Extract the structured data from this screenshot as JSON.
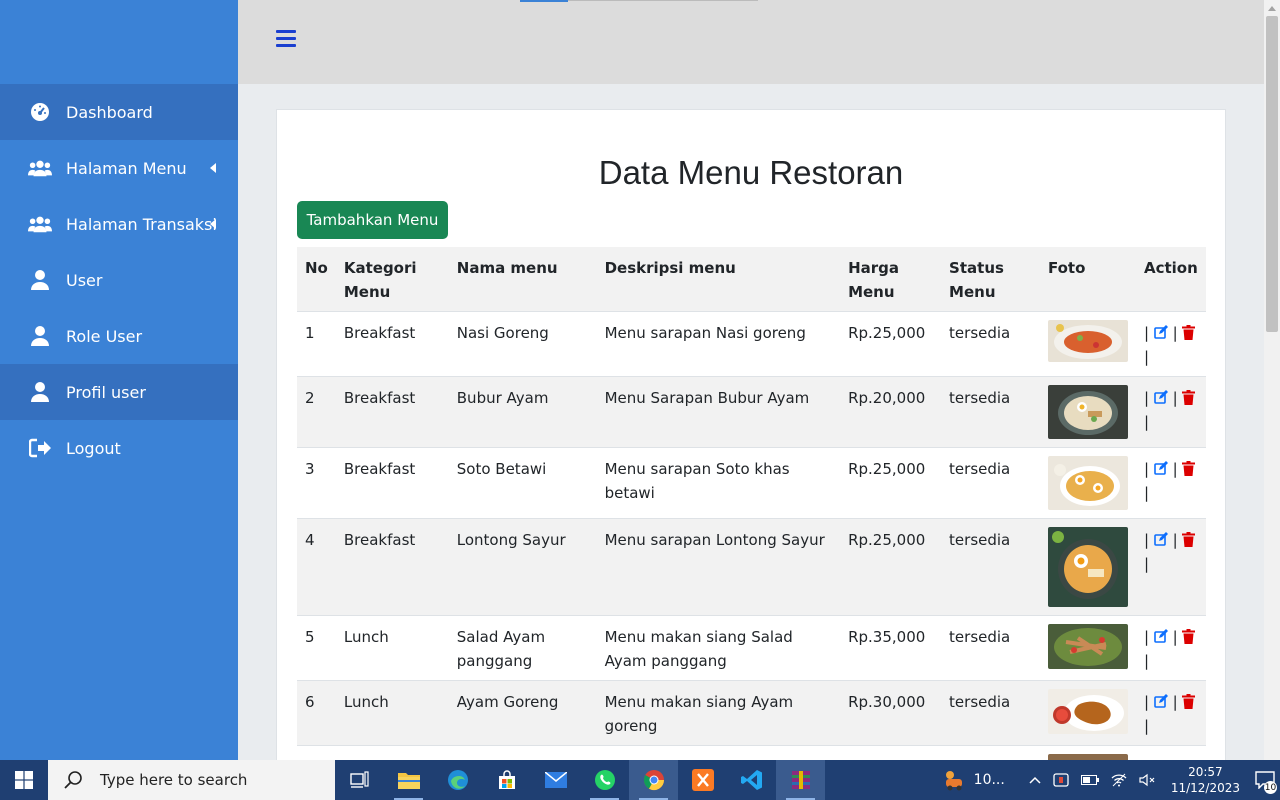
{
  "sidebar": {
    "items": [
      {
        "label": "Dashboard",
        "icon": "gauge-icon"
      },
      {
        "label": "Halaman Menu",
        "icon": "users-icon"
      },
      {
        "label": "Halaman Transaksi",
        "icon": "users-icon"
      },
      {
        "label": "User",
        "icon": "user-icon"
      },
      {
        "label": "Role User",
        "icon": "user-icon"
      },
      {
        "label": "Profil user",
        "icon": "user-icon"
      },
      {
        "label": "Logout",
        "icon": "logout-icon"
      }
    ]
  },
  "page": {
    "title": "Data Menu Restoran",
    "add_button": "Tambahkan Menu"
  },
  "table": {
    "headers": [
      "No",
      "Kategori Menu",
      "Nama menu",
      "Deskripsi menu",
      "Harga Menu",
      "Status Menu",
      "Foto",
      "Action"
    ],
    "rows": [
      {
        "no": "1",
        "kategori": "Breakfast",
        "nama": "Nasi Goreng",
        "deskripsi": "Menu sarapan Nasi goreng",
        "harga": "Rp.25,000",
        "status": "tersedia"
      },
      {
        "no": "2",
        "kategori": "Breakfast",
        "nama": "Bubur Ayam",
        "deskripsi": "Menu Sarapan Bubur Ayam",
        "harga": "Rp.20,000",
        "status": "tersedia"
      },
      {
        "no": "3",
        "kategori": "Breakfast",
        "nama": "Soto Betawi",
        "deskripsi": "Menu sarapan Soto khas betawi",
        "harga": "Rp.25,000",
        "status": "tersedia"
      },
      {
        "no": "4",
        "kategori": "Breakfast",
        "nama": "Lontong Sayur",
        "deskripsi": "Menu sarapan Lontong Sayur",
        "harga": "Rp.25,000",
        "status": "tersedia"
      },
      {
        "no": "5",
        "kategori": "Lunch",
        "nama": "Salad Ayam panggang",
        "deskripsi": "Menu makan siang Salad Ayam panggang",
        "harga": "Rp.35,000",
        "status": "tersedia"
      },
      {
        "no": "6",
        "kategori": "Lunch",
        "nama": "Ayam Goreng",
        "deskripsi": "Menu makan siang Ayam goreng",
        "harga": "Rp.30,000",
        "status": "tersedia"
      }
    ],
    "action_separator": "|"
  },
  "taskbar": {
    "search_placeholder": "Type here to search",
    "tray_weather": "10...",
    "time": "20:57",
    "date": "11/12/2023",
    "notifications": "10"
  },
  "colors": {
    "sidebar": "#3b82d6",
    "add_button": "#198754",
    "edit_icon": "#0d6efd",
    "delete_icon": "#dc0000"
  }
}
